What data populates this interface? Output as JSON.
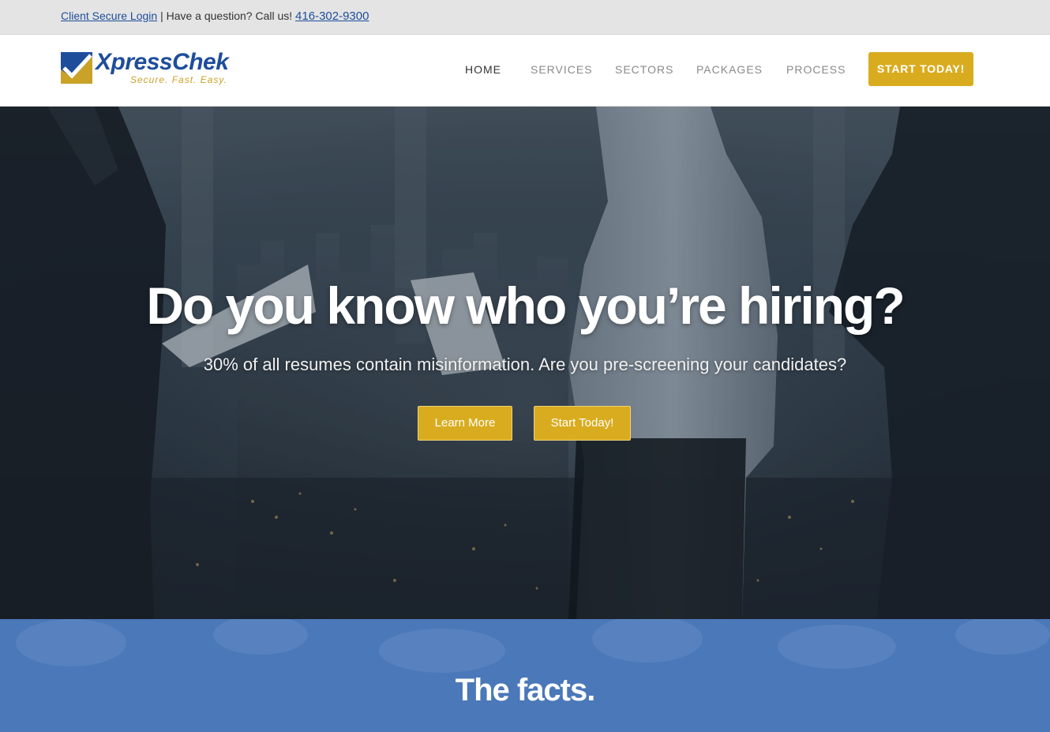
{
  "topbar": {
    "login_link": "Client Secure Login",
    "separator": "|",
    "question_text": "Have a question? Call us!",
    "phone": "416-302-9300"
  },
  "logo": {
    "name": "XpressChek",
    "tagline": "Secure. Fast. Easy."
  },
  "nav": {
    "items": [
      {
        "label": "HOME",
        "active": true
      },
      {
        "label": "SERVICES",
        "active": false
      },
      {
        "label": "SECTORS",
        "active": false
      },
      {
        "label": "PACKAGES",
        "active": false
      },
      {
        "label": "PROCESS",
        "active": false
      }
    ],
    "cta_label": "START TODAY!"
  },
  "hero": {
    "title": "Do you know who you’re hiring?",
    "subtitle": "30% of all resumes contain misinformation. Are you pre-screening your candidates?",
    "buttons": {
      "learn_more": "Learn More",
      "start_today": "Start Today!"
    }
  },
  "facts": {
    "title": "The facts."
  },
  "colors": {
    "brand_blue": "#1e4d9b",
    "brand_gold": "#d9ac1f",
    "facts_bg": "#4a78b8"
  }
}
